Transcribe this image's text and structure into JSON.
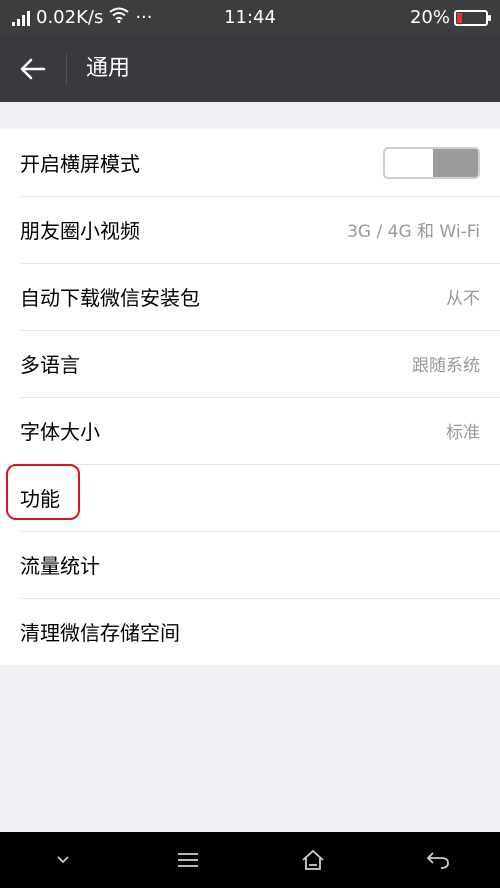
{
  "status_bar": {
    "network_speed": "0.02K/s",
    "more": "···",
    "time": "11:44",
    "battery": "20%"
  },
  "header": {
    "title": "通用"
  },
  "settings": [
    {
      "label": "开启横屏模式",
      "value": "",
      "type": "toggle"
    },
    {
      "label": "朋友圈小视频",
      "value": "3G / 4G 和 Wi-Fi"
    },
    {
      "label": "自动下载微信安装包",
      "value": "从不"
    },
    {
      "label": "多语言",
      "value": "跟随系统"
    },
    {
      "label": "字体大小",
      "value": "标准"
    },
    {
      "label": "功能",
      "value": ""
    },
    {
      "label": "流量统计",
      "value": ""
    },
    {
      "label": "清理微信存储空间",
      "value": ""
    }
  ],
  "colors": {
    "header_bg": "#393a3f",
    "highlight": "#e0141e"
  },
  "icons": {
    "back": "arrow-left-icon",
    "nav_down": "chevron-down-icon",
    "nav_menu": "menu-icon",
    "nav_home": "home-icon",
    "nav_back": "return-arrow-icon"
  }
}
